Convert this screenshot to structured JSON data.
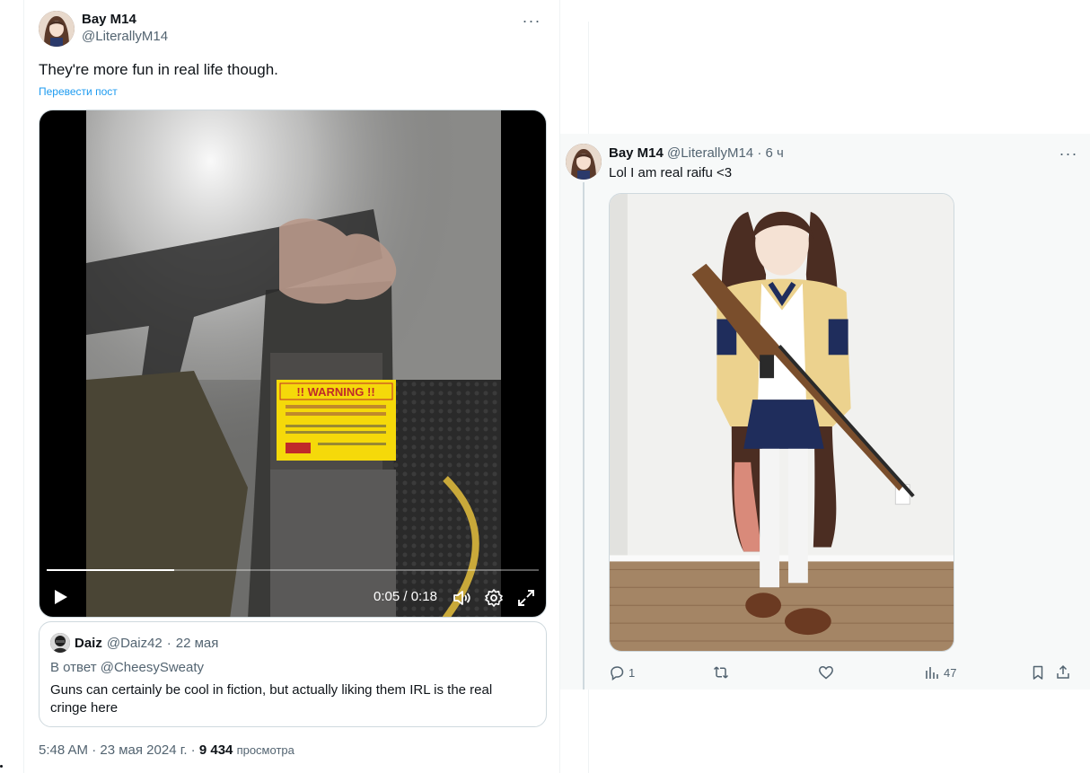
{
  "main_tweet": {
    "author_name": "Bay M14",
    "author_handle": "@LiterallyM14",
    "more_label": "···",
    "text": "They're more fun in real life though.",
    "translate_label": "Перевести пост",
    "video": {
      "current_time": "0:05",
      "separator": " / ",
      "duration": "0:18",
      "progress_fraction": 0.26,
      "sign_title": "!! WARNING !!",
      "sign_subtitle": "Tracer and Incendiary ammunition are Not Permitted"
    },
    "quote": {
      "author_name": "Daiz",
      "author_handle": "@Daiz42",
      "date": "22 мая",
      "reply_to": "В ответ @CheesySweaty",
      "text": "Guns can certainly be cool in fiction, but actually liking them IRL is the real cringe here"
    },
    "timestamp": "5:48 AM · 23 мая 2024 г. · ",
    "views_count": "9 434",
    "views_label": "просмотра"
  },
  "reply_tweet": {
    "author_name": "Bay M14",
    "author_handle": "@LiterallyM14",
    "age": "6 ч",
    "more_label": "···",
    "text": "Lol I am real raifu <3",
    "actions": {
      "replies": "1",
      "retweets": "",
      "likes": "",
      "views": "47"
    }
  },
  "colors": {
    "text_primary": "#0f1419",
    "text_secondary": "#536471",
    "link_blue": "#1d9bf0",
    "border": "#cfd9de",
    "panel_bg": "#f7f9f9"
  },
  "icons": [
    "more-icon",
    "play-icon",
    "volume-icon",
    "settings-icon",
    "fullscreen-icon",
    "reply-icon",
    "retweet-icon",
    "like-icon",
    "views-icon",
    "bookmark-icon",
    "share-icon"
  ]
}
